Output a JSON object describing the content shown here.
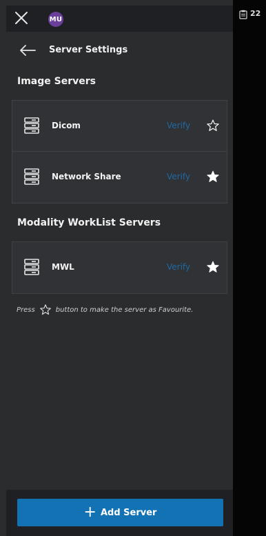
{
  "topbar": {
    "avatar_initials": "MU"
  },
  "header": {
    "title": "Server Settings"
  },
  "image_servers": {
    "title": "Image Servers",
    "items": [
      {
        "name": "Dicom",
        "verify": "Verify",
        "favourite": false
      },
      {
        "name": "Network Share",
        "verify": "Verify",
        "favourite": true
      }
    ]
  },
  "worklist_servers": {
    "title": "Modality WorkList Servers",
    "items": [
      {
        "name": "MWL",
        "verify": "Verify",
        "favourite": true
      }
    ]
  },
  "hint": {
    "before": "Press",
    "after": "button to make the server as Favourite."
  },
  "footer": {
    "add_label": "Add Server",
    "add_icon": "+"
  },
  "status": {
    "text": "22",
    "icon": "clipboard-icon"
  },
  "colors": {
    "accent": "#1372b3",
    "verify": "#1f6aa3",
    "panel": "#2b2c2e",
    "avatar": "#6a3f9a"
  }
}
